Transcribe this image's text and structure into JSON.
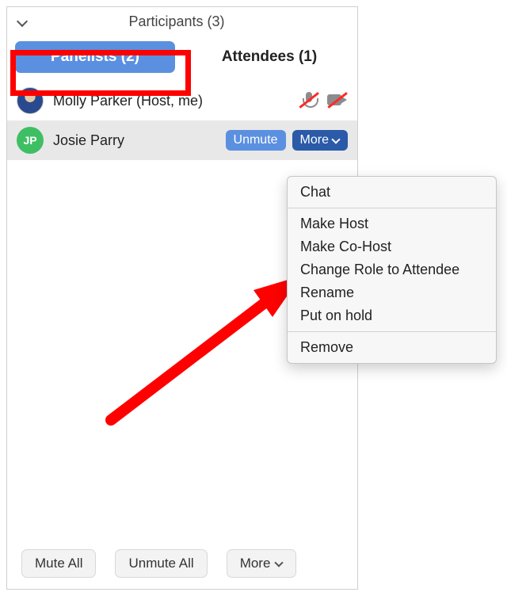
{
  "header": {
    "title": "Participants (3)"
  },
  "tabs": {
    "panelists": {
      "label": "Panelists (2)",
      "active": true
    },
    "attendees": {
      "label": "Attendees (1)",
      "active": false
    }
  },
  "participants": [
    {
      "name": "Molly Parker (Host, me)",
      "avatar_type": "photo",
      "initials": "",
      "mic_muted": true,
      "cam_off": true
    },
    {
      "name": "Josie Parry",
      "avatar_type": "initials",
      "initials": "JP",
      "selected": true,
      "actions": {
        "unmute": "Unmute",
        "more": "More"
      }
    }
  ],
  "more_menu": {
    "group1": [
      "Chat"
    ],
    "group2": [
      "Make Host",
      "Make Co-Host",
      "Change Role to Attendee",
      "Rename",
      "Put on hold"
    ],
    "group3": [
      "Remove"
    ]
  },
  "bottom_bar": {
    "mute_all": "Mute All",
    "unmute_all": "Unmute All",
    "more": "More"
  },
  "colors": {
    "accent_blue": "#5b90e0",
    "dark_blue": "#2a5aa8",
    "highlight_red": "#ff0000",
    "avatar_green": "#3fbf63"
  }
}
